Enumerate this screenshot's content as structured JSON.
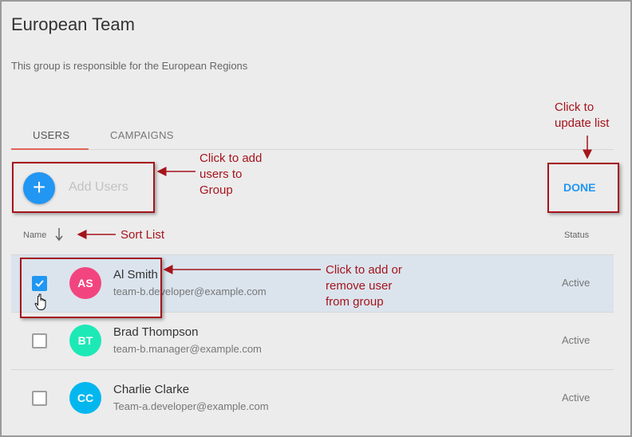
{
  "group": {
    "title": "European Team",
    "description": "This group is responsible for the European Regions"
  },
  "tabs": [
    {
      "label": "USERS",
      "active": true
    },
    {
      "label": "CAMPAIGNS",
      "active": false
    }
  ],
  "toolbar": {
    "add_icon": "plus-icon",
    "add_label": "Add Users",
    "done_label": "DONE"
  },
  "list_header": {
    "name_label": "Name",
    "sort_icon": "arrow-down-icon",
    "status_label": "Status"
  },
  "users": [
    {
      "initials": "AS",
      "name": "Al Smith",
      "email": "team-b.developer@example.com",
      "status": "Active",
      "checked": true,
      "avatar_color": "#f2457f"
    },
    {
      "initials": "BT",
      "name": "Brad Thompson",
      "email": "team-b.manager@example.com",
      "status": "Active",
      "checked": false,
      "avatar_color": "#1de9b6"
    },
    {
      "initials": "CC",
      "name": "Charlie Clarke",
      "email": "Team-a.developer@example.com",
      "status": "Active",
      "checked": false,
      "avatar_color": "#03b7ee"
    }
  ],
  "annotations": {
    "update_list": [
      "Click to",
      "update list"
    ],
    "add_users": [
      "Click to add",
      "users to",
      "Group"
    ],
    "sort_list": [
      "Sort List"
    ],
    "add_remove": [
      "Click to add or",
      "remove user",
      "from group"
    ]
  },
  "colors": {
    "accent": "#2196f3",
    "tab_indicator": "#e06457",
    "annotation": "#a5141c",
    "selected_row": "#dbe4ed"
  }
}
